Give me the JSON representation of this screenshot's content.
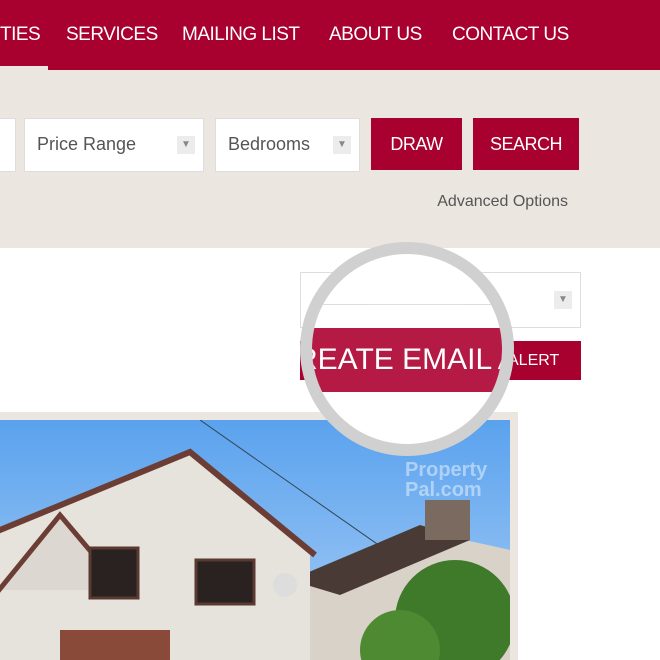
{
  "nav": {
    "items": [
      "TIES",
      "SERVICES",
      "MAILING LIST",
      "ABOUT US",
      "CONTACT US"
    ],
    "active": "TIES"
  },
  "search": {
    "price_range": "Price Range",
    "bedrooms": "Bedrooms",
    "draw": "DRAW",
    "search": "SEARCH",
    "advanced": "Advanced Options"
  },
  "alert": {
    "button_label": "ALERT",
    "magnified_label": "REATE EMAIL AL"
  },
  "photo": {
    "watermark_line1": "Property",
    "watermark_line2": "Pal.com"
  },
  "colors": {
    "brand": "#a8002f",
    "band": "#ebe6e0"
  }
}
